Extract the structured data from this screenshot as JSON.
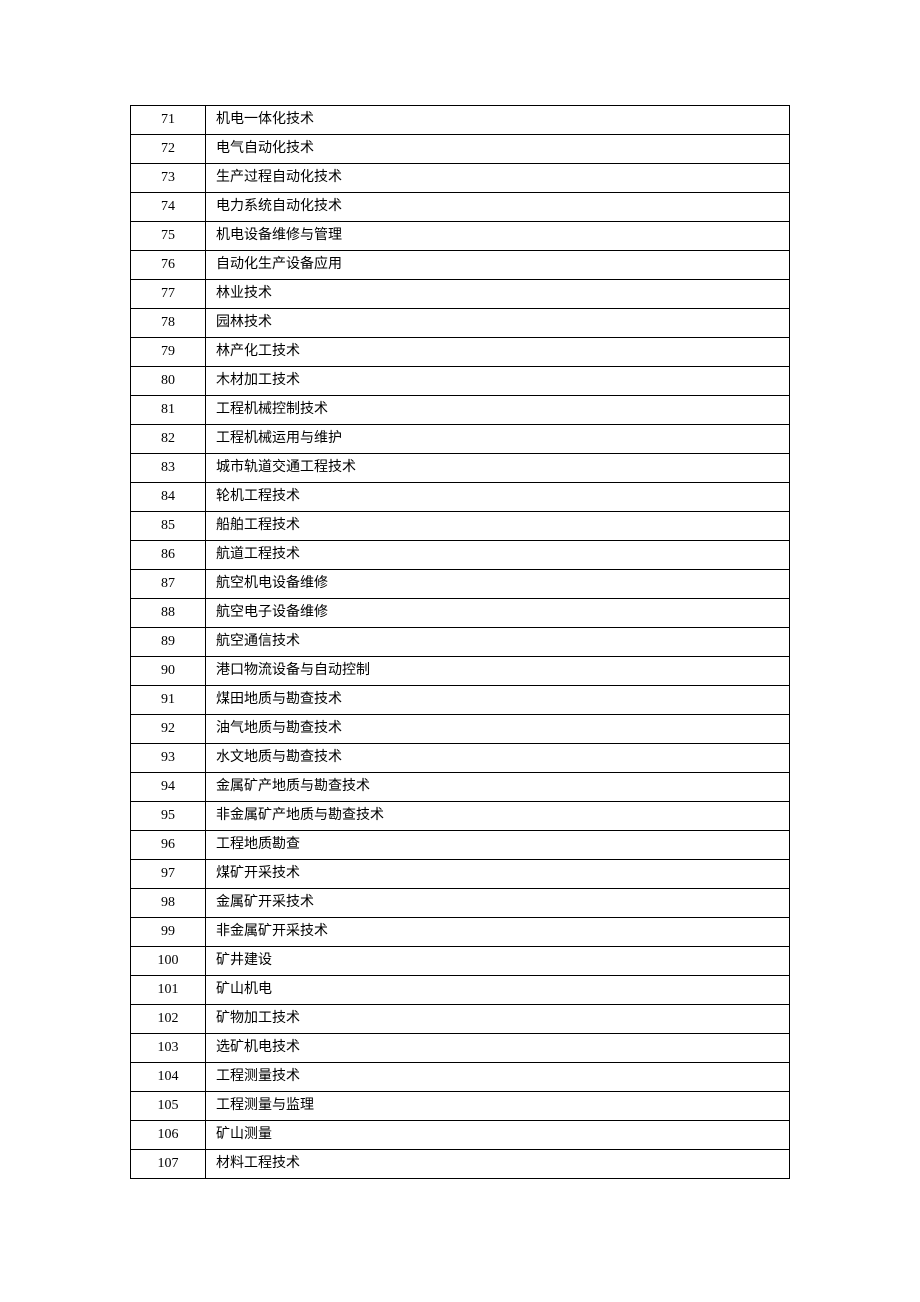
{
  "rows": [
    {
      "num": "71",
      "name": "机电一体化技术"
    },
    {
      "num": "72",
      "name": "电气自动化技术"
    },
    {
      "num": "73",
      "name": "生产过程自动化技术"
    },
    {
      "num": "74",
      "name": "电力系统自动化技术"
    },
    {
      "num": "75",
      "name": "机电设备维修与管理"
    },
    {
      "num": "76",
      "name": "自动化生产设备应用"
    },
    {
      "num": "77",
      "name": "林业技术"
    },
    {
      "num": "78",
      "name": "园林技术"
    },
    {
      "num": "79",
      "name": "林产化工技术"
    },
    {
      "num": "80",
      "name": "木材加工技术"
    },
    {
      "num": "81",
      "name": "工程机械控制技术"
    },
    {
      "num": "82",
      "name": "工程机械运用与维护"
    },
    {
      "num": "83",
      "name": "城市轨道交通工程技术"
    },
    {
      "num": "84",
      "name": "轮机工程技术"
    },
    {
      "num": "85",
      "name": "船舶工程技术"
    },
    {
      "num": "86",
      "name": "航道工程技术"
    },
    {
      "num": "87",
      "name": "航空机电设备维修"
    },
    {
      "num": "88",
      "name": "航空电子设备维修"
    },
    {
      "num": "89",
      "name": "航空通信技术"
    },
    {
      "num": "90",
      "name": "港口物流设备与自动控制"
    },
    {
      "num": "91",
      "name": "煤田地质与勘查技术"
    },
    {
      "num": "92",
      "name": "油气地质与勘查技术"
    },
    {
      "num": "93",
      "name": "水文地质与勘查技术"
    },
    {
      "num": "94",
      "name": "金属矿产地质与勘查技术"
    },
    {
      "num": "95",
      "name": "非金属矿产地质与勘查技术"
    },
    {
      "num": "96",
      "name": "工程地质勘查"
    },
    {
      "num": "97",
      "name": "煤矿开采技术"
    },
    {
      "num": "98",
      "name": "金属矿开采技术"
    },
    {
      "num": "99",
      "name": "非金属矿开采技术"
    },
    {
      "num": "100",
      "name": "矿井建设"
    },
    {
      "num": "101",
      "name": "矿山机电"
    },
    {
      "num": "102",
      "name": "矿物加工技术"
    },
    {
      "num": "103",
      "name": "选矿机电技术"
    },
    {
      "num": "104",
      "name": "工程测量技术"
    },
    {
      "num": "105",
      "name": "工程测量与监理"
    },
    {
      "num": "106",
      "name": "矿山测量"
    },
    {
      "num": "107",
      "name": "材料工程技术"
    }
  ]
}
